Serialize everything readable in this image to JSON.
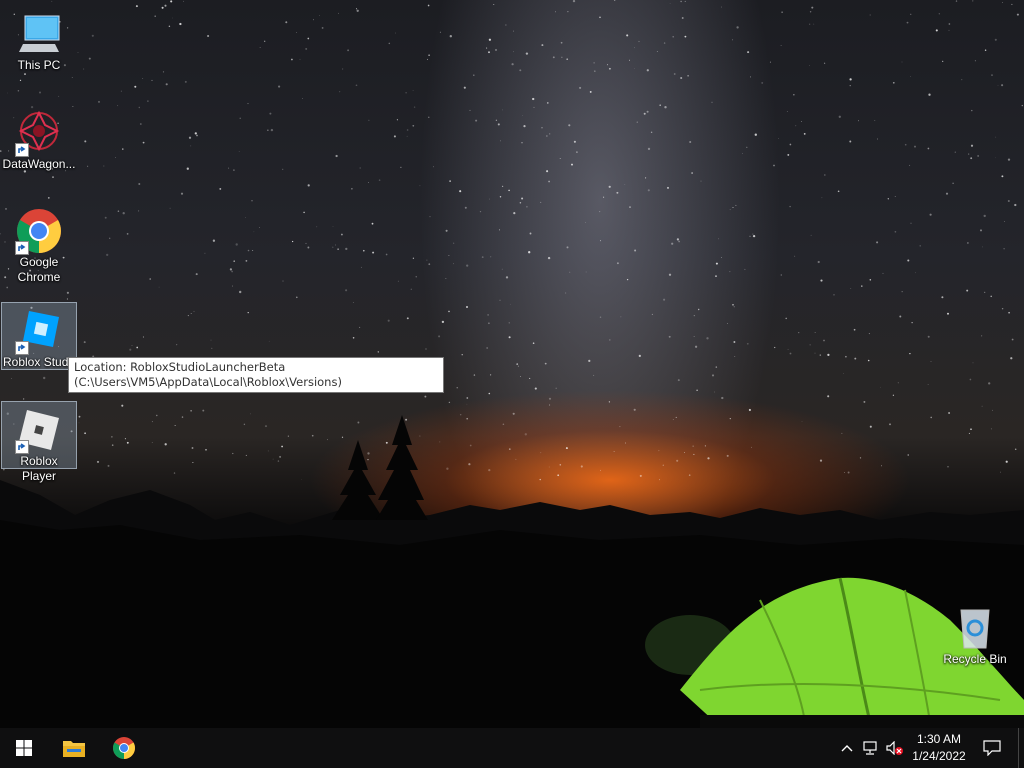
{
  "desktop_icons": [
    {
      "label": "This PC",
      "icon": "this-pc-icon"
    },
    {
      "label": "DataWagon...",
      "icon": "datawagon-icon"
    },
    {
      "label": "Google Chrome",
      "icon": "chrome-icon"
    },
    {
      "label": "Roblox Stud",
      "icon": "roblox-studio-icon"
    },
    {
      "label": "Roblox Player",
      "icon": "roblox-player-icon"
    },
    {
      "label": "Recycle Bin",
      "icon": "recycle-bin-icon"
    }
  ],
  "tooltip": {
    "text": "Location: RobloxStudioLauncherBeta (C:\\Users\\VM5\\AppData\\Local\\Roblox\\Versions)"
  },
  "taskbar": {
    "pinned": [
      "windows-start-icon",
      "file-explorer-icon",
      "chrome-icon"
    ],
    "tray_icons": [
      "chevron-up-icon",
      "network-icon",
      "volume-muted-icon",
      "notification-icon"
    ],
    "clock": {
      "time": "1:30 AM",
      "date": "1/24/2022"
    }
  },
  "colors": {
    "taskbar": "#0f0f10",
    "tent": "#8fe23a",
    "horizon_glow": "#ff6e14"
  }
}
